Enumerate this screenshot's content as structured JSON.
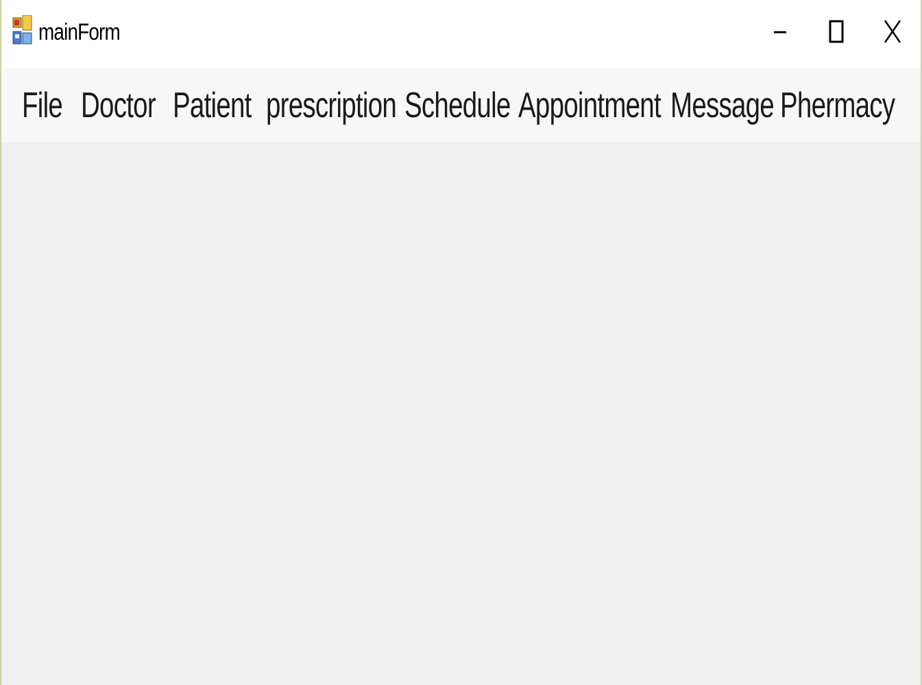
{
  "window": {
    "title": "mainForm",
    "app_icon": "form-icon",
    "controls": {
      "minimize_icon": "minimize-icon",
      "maximize_icon": "maximize-icon",
      "close_icon": "close-icon"
    }
  },
  "menu": {
    "items": [
      {
        "label": "File"
      },
      {
        "label": "Doctor"
      },
      {
        "label": "Patient"
      },
      {
        "label": "prescription"
      },
      {
        "label": "Schedule"
      },
      {
        "label": "Appointment"
      },
      {
        "label": "Message"
      },
      {
        "label": "Phermacy"
      }
    ]
  },
  "colors": {
    "titlebar": "#ffffff",
    "menubar": "#f7f7f7",
    "client": "#f0f0f0",
    "border": "#c9d3a6",
    "text": "#1a1a1a"
  }
}
